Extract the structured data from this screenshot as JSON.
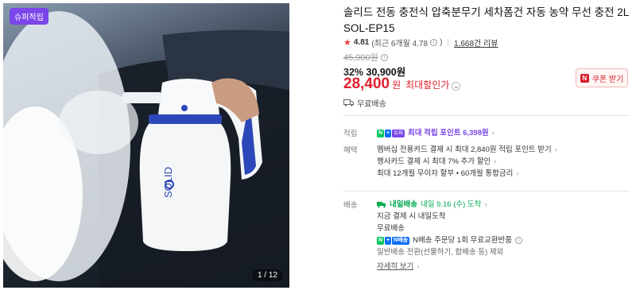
{
  "image": {
    "badge": "슈퍼적립",
    "counter": "1 / 12",
    "brand_text": "SOLID",
    "colors": {
      "accent": "#2c48b8",
      "bottle": "#f4f6f8"
    }
  },
  "product": {
    "title": "솔리드 전동 충전식 압축분무기 세차폼건 자동 농약 무선 충전 2L SOL-EP15",
    "rating": "4.81",
    "rating_detail": "(최근 6개월 4.78",
    "rating_close": ")",
    "review_count": "1,668건 리뷰",
    "original_price": "45,900원",
    "discount_pct": "32%",
    "sale_price": "30,900원",
    "final_price": "28,400",
    "final_unit": "원",
    "max_discount_label": "최대할인가",
    "coupon_button": "쿠폰 받기",
    "coupon_n": "N",
    "shipping_free": "무료배송"
  },
  "benefits": {
    "point_label": "적립",
    "point_n": "N",
    "point_plus": "+",
    "point_super": "슈퍼",
    "point_text": "최대 적립 포인트 6,398원",
    "perk_label": "혜택",
    "perks": [
      "멤버십 전용카드 결제 시 최대 2,840원 적립 포인트 받기",
      "행사카드 결제 시 최대 7% 추가 할인",
      "최대 12개월 무이자 할부 • 60개월 통합금리"
    ]
  },
  "delivery": {
    "label": "배송",
    "tag": "내일배송",
    "arrival": "내일 9.16 (수) 도착",
    "line1": "지금 결제 시 내일도착",
    "line2": "무료배송",
    "nplus_badge": "N배송",
    "nplus_text": "N배송 주문당 1회 무료교환반품",
    "line4": "일반배송 전환(선물하기, 합배송 등) 제외",
    "more": "자세히 보기"
  },
  "colors": {
    "price_red": "#e0202e",
    "point_purple": "#7a46e8",
    "naver_green": "#03c75a"
  }
}
